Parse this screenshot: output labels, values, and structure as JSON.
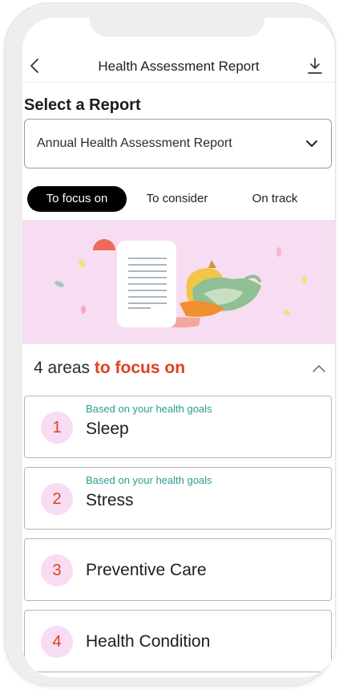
{
  "header": {
    "title": "Health Assessment Report",
    "back_icon": "back-arrow-icon",
    "download_icon": "download-icon"
  },
  "report_selector": {
    "label": "Select a Report",
    "value": "Annual Health Assessment Report"
  },
  "tabs": [
    {
      "label": "To focus on",
      "active": true
    },
    {
      "label": "To consider",
      "active": false
    },
    {
      "label": "On track",
      "active": false
    }
  ],
  "banner": {
    "background": "#f6ddf1",
    "illustration": "report-and-vegetables-illustration"
  },
  "areas": {
    "count": "4",
    "text": "areas",
    "accent": "to focus on",
    "accent_color": "#e0401f"
  },
  "items": [
    {
      "number": "1",
      "note": "Based on your health goals",
      "title": "Sleep"
    },
    {
      "number": "2",
      "note": "Based on your health goals",
      "title": "Stress"
    },
    {
      "number": "3",
      "note": "",
      "title": "Preventive Care"
    },
    {
      "number": "4",
      "note": "",
      "title": "Health Condition"
    }
  ]
}
